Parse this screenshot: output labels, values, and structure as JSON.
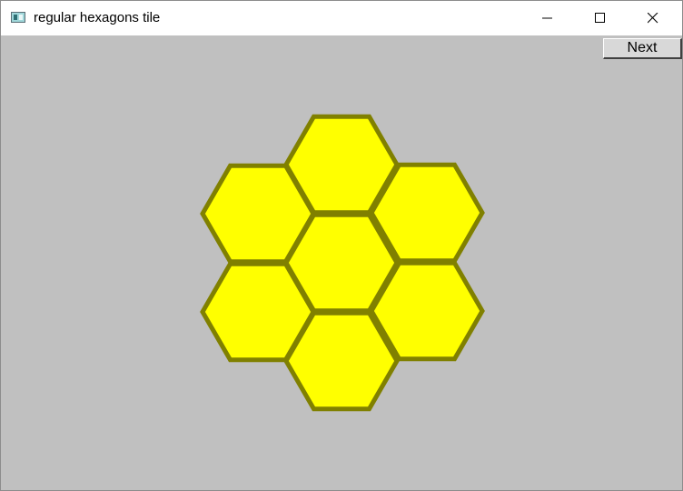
{
  "window": {
    "title": "regular hexagons tile",
    "controls": [
      "minimize",
      "maximize",
      "close"
    ]
  },
  "toolbar": {
    "next_label": "Next"
  },
  "tiling": {
    "tile_count": 7,
    "fill_color": "#ffff00",
    "stroke_color": "#808000",
    "background_color": "#c0c0c0"
  }
}
